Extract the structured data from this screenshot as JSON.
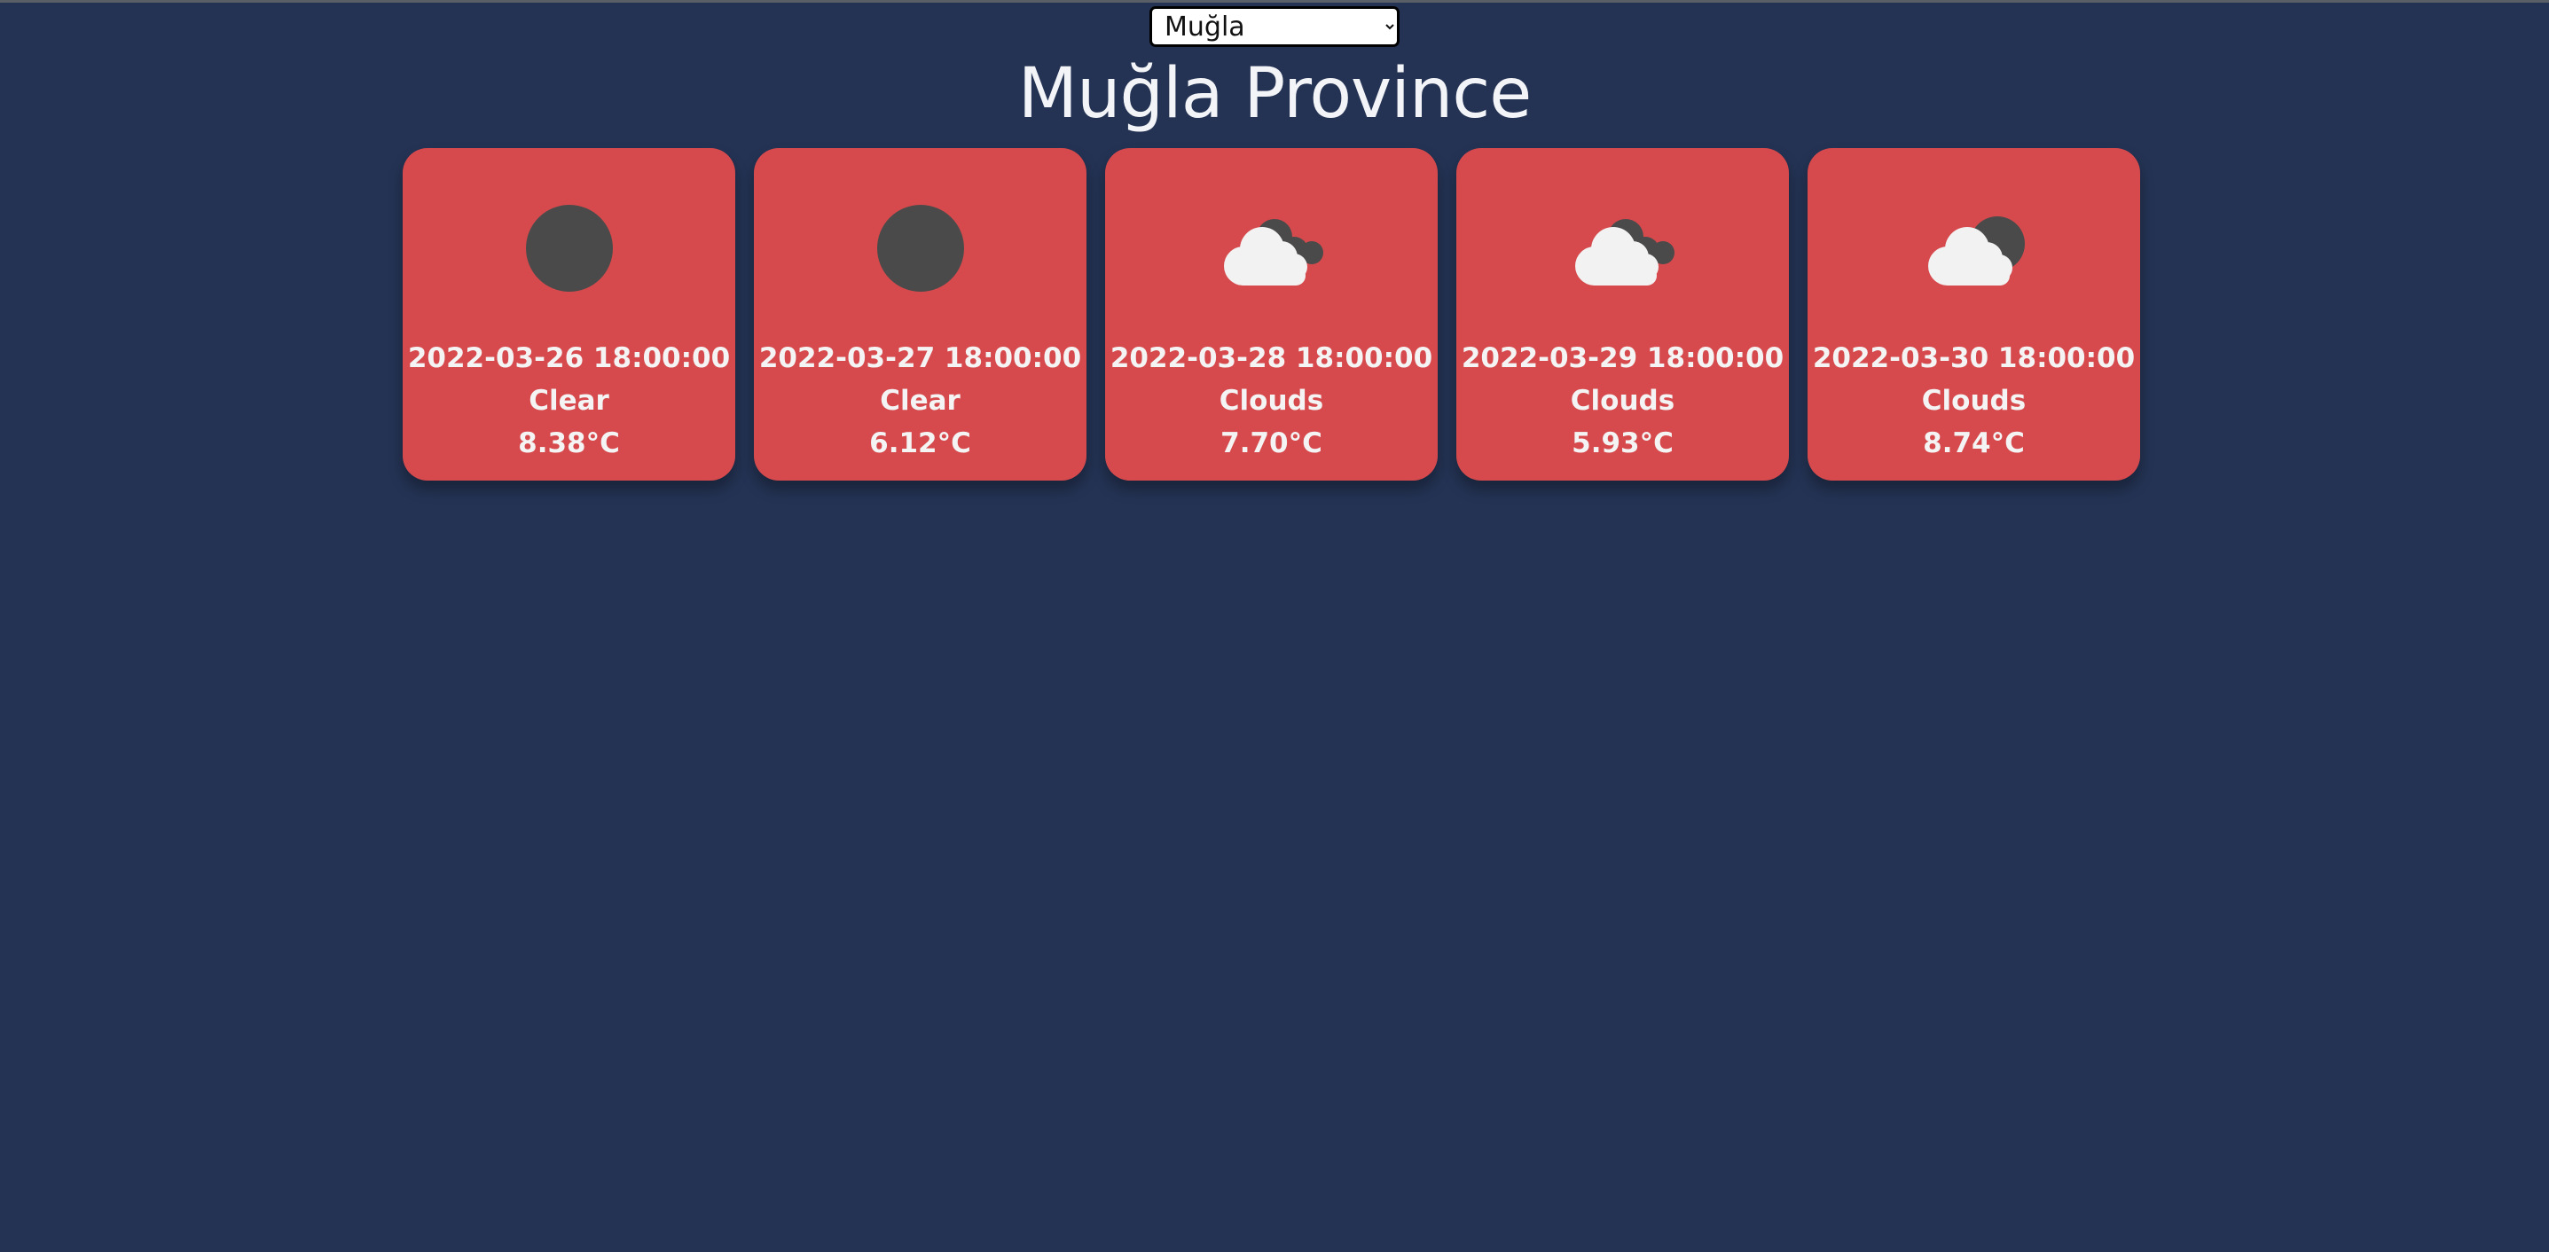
{
  "header": {
    "selected_city": "Muğla",
    "title": "Muğla Province"
  },
  "forecast": [
    {
      "datetime": "2022-03-26 18:00:00",
      "condition": "Clear",
      "temperature": "8.38°C",
      "icon": "moon-icon"
    },
    {
      "datetime": "2022-03-27 18:00:00",
      "condition": "Clear",
      "temperature": "6.12°C",
      "icon": "moon-icon"
    },
    {
      "datetime": "2022-03-28 18:00:00",
      "condition": "Clouds",
      "temperature": "7.70°C",
      "icon": "cloud-icon"
    },
    {
      "datetime": "2022-03-29 18:00:00",
      "condition": "Clouds",
      "temperature": "5.93°C",
      "icon": "cloud-icon"
    },
    {
      "datetime": "2022-03-30 18:00:00",
      "condition": "Clouds",
      "temperature": "8.74°C",
      "icon": "cloud-moon-icon"
    }
  ],
  "colors": {
    "background": "#243354",
    "card": "#d64a4d",
    "icon_dark": "#4a4a4a",
    "cloud": "#f2f2f2"
  }
}
